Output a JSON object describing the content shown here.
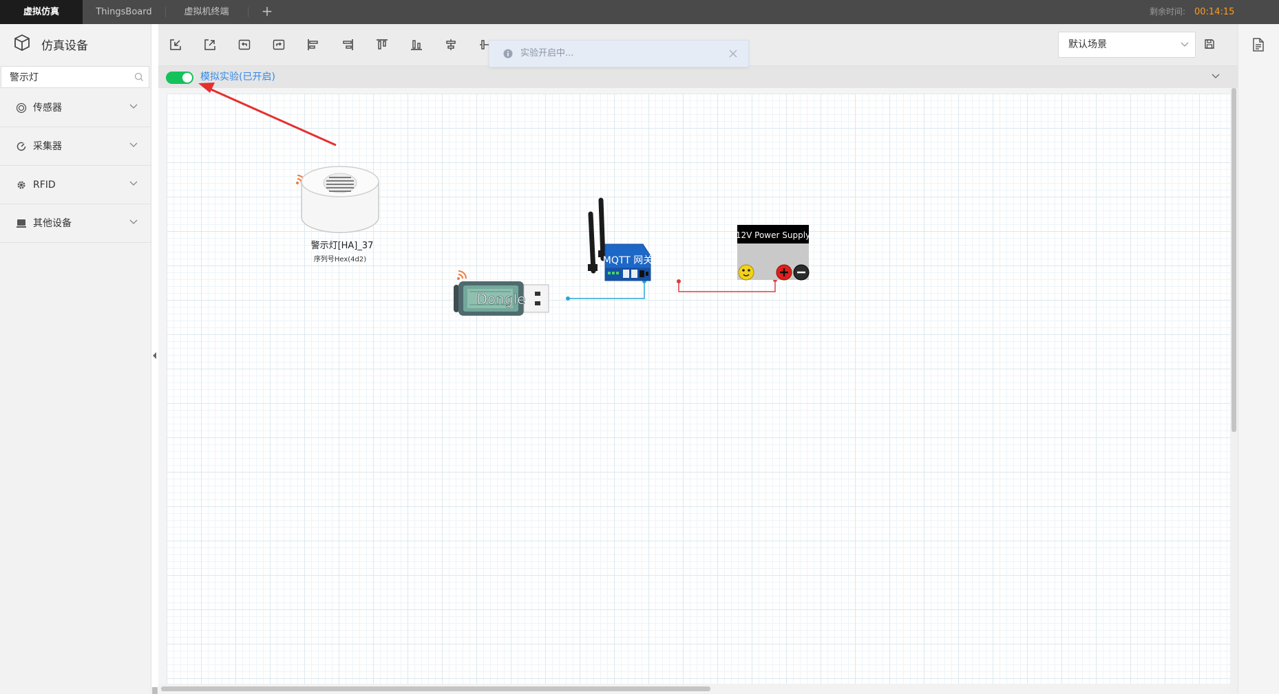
{
  "tabs": [
    {
      "label": "虚拟仿真",
      "active": true
    },
    {
      "label": "ThingsBoard",
      "active": false
    },
    {
      "label": "虚拟机终端",
      "active": false
    }
  ],
  "add_tab_label": "+",
  "timer": {
    "label": "剩余时间:",
    "value": "00:14:15"
  },
  "sidebar": {
    "title": "仿真设备",
    "search": {
      "value": "警示灯"
    },
    "categories": [
      {
        "label": "传感器",
        "icon": "sensor-icon"
      },
      {
        "label": "采集器",
        "icon": "collector-icon"
      },
      {
        "label": "RFID",
        "icon": "gear-icon"
      },
      {
        "label": "其他设备",
        "icon": "device-icon"
      }
    ]
  },
  "toolbar": {
    "tools": [
      "import-icon",
      "export-icon",
      "undo-icon",
      "redo-icon",
      "align-left-icon",
      "align-right-icon",
      "align-top-icon",
      "align-bottom-icon",
      "align-center-h-icon",
      "align-center-v-icon"
    ],
    "scene_select": {
      "value": "默认场景"
    }
  },
  "simulation": {
    "label": "模拟实验(已开启)",
    "enabled": true
  },
  "notice": {
    "text": "实验开启中..."
  },
  "canvas": {
    "devices": {
      "alarm_light": {
        "name": "警示灯[HA]_37",
        "serial": "序列号Hex(4d2)"
      },
      "dongle": {
        "name": "Dongle"
      },
      "gateway": {
        "name": "MQTT 网关"
      },
      "power_supply": {
        "name": "12V Power Supply"
      }
    }
  },
  "colors": {
    "accent": "#3388e8",
    "toggle_on": "#13c25a",
    "timer": "#ff9a1e",
    "wire_blue": "#2aa6d6",
    "wire_red": "#e23b3b",
    "arrow": "#e53030"
  }
}
